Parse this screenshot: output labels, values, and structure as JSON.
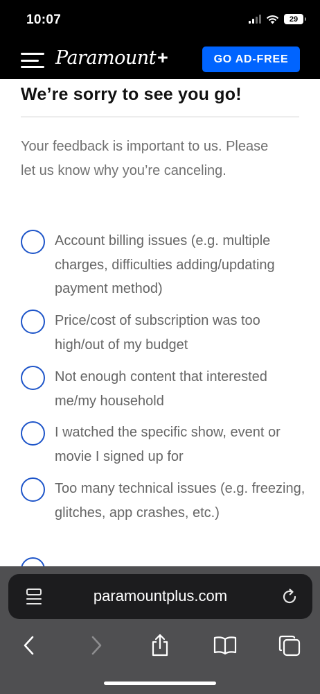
{
  "status_bar": {
    "time": "10:07",
    "battery": "29",
    "icons": [
      "signal-icon",
      "wifi-icon",
      "battery-icon"
    ]
  },
  "header": {
    "logo": "Paramount",
    "logo_plus": "+",
    "cta_label": "GO AD-FREE",
    "cta_color": "#0064ff",
    "menu_icon": "hamburger-menu-icon"
  },
  "main": {
    "title": "We’re sorry to see you go!",
    "intro": "Your feedback is important to us. Please let us know why you’re canceling.",
    "options": [
      "Account billing issues (e.g. multiple charges, difficulties adding/updating payment method)",
      "Price/cost of subscription was too high/out of my budget",
      "Not enough content that interested me/my household",
      "I watched the specific show, event or movie I signed up for",
      "Too many technical issues (e.g. freezing, glitches, app crashes, etc.)"
    ],
    "radio_color": "#1e55c9"
  },
  "browser": {
    "url": "paramountplus.com",
    "toolbar_icons": [
      "back-icon",
      "forward-icon",
      "share-icon",
      "bookmarks-icon",
      "tabs-icon"
    ]
  }
}
